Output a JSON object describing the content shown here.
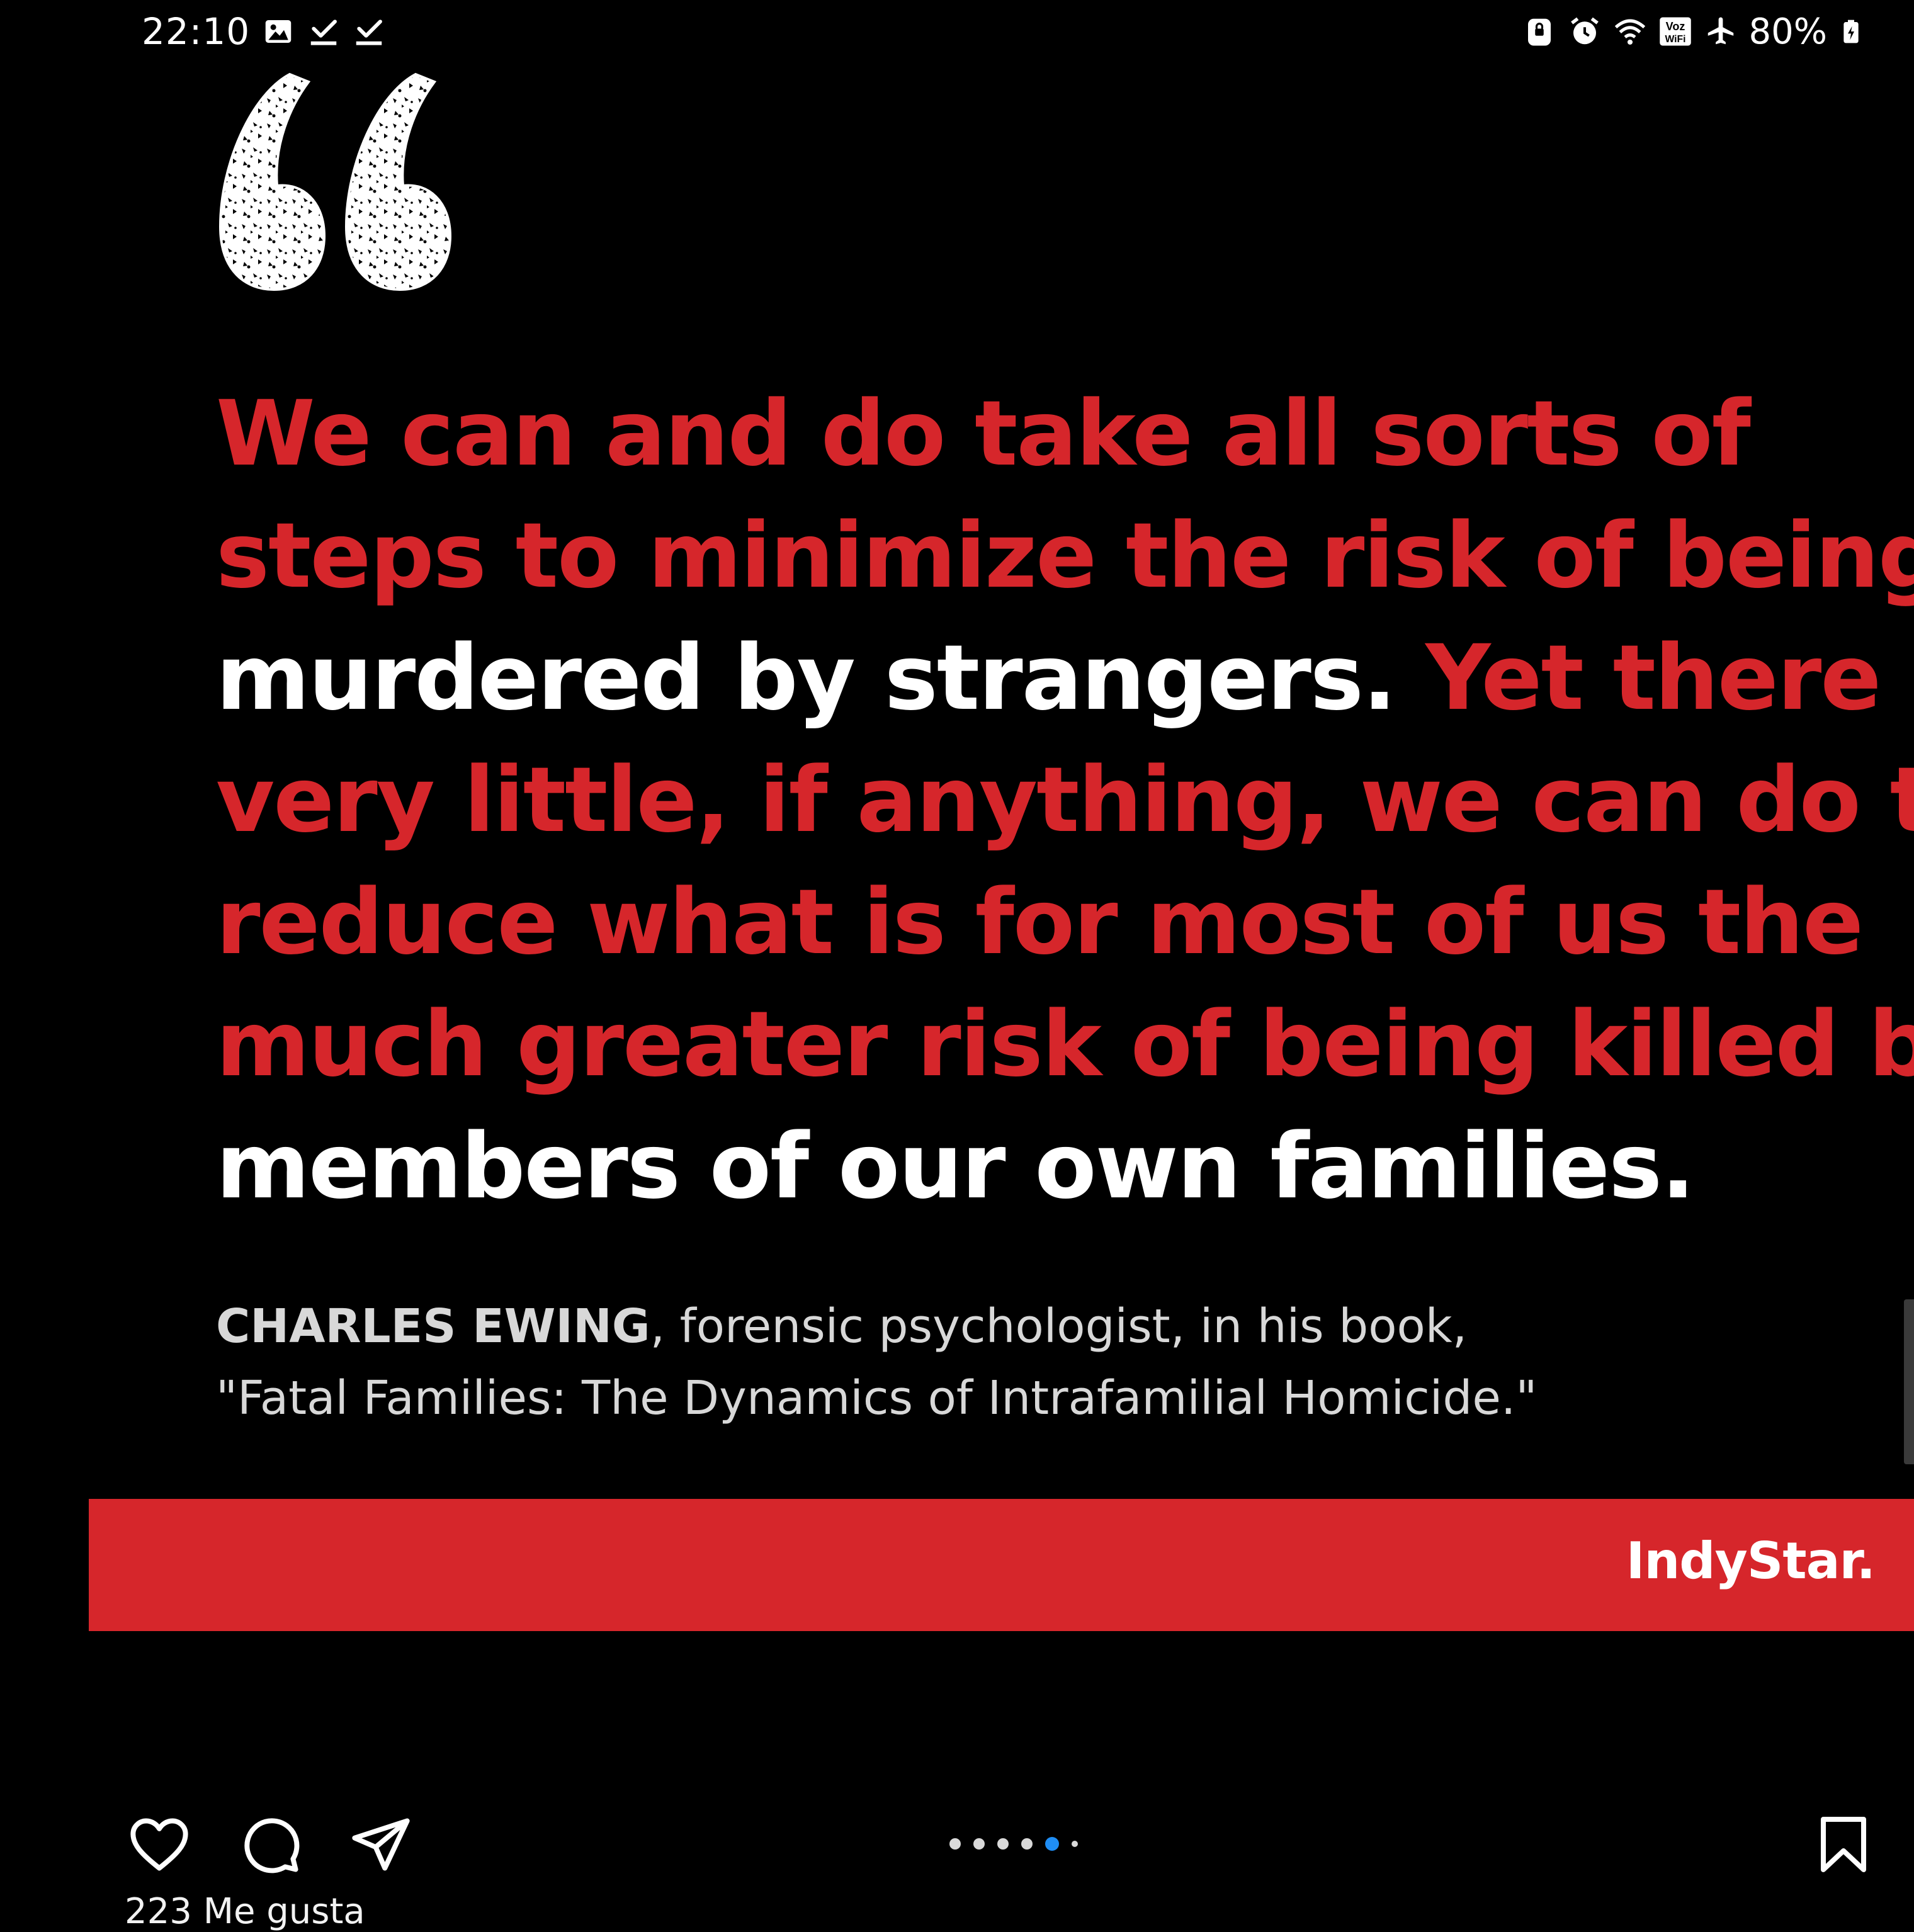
{
  "status_bar": {
    "time": "22:10",
    "battery": "80%",
    "left_icons": [
      "gallery-icon",
      "check-download-icon",
      "check-download-icon"
    ],
    "right_icons": [
      "lock-icon",
      "alarm-icon",
      "wifi-icon",
      "vowifi-icon",
      "airplane-icon",
      "battery-charging-icon"
    ],
    "vowifi_label_top": "Voz",
    "vowifi_label_bottom": "WiFi"
  },
  "post": {
    "quote_lines": [
      [
        {
          "text": "We can and do take all sorts of",
          "color": "red"
        }
      ],
      [
        {
          "text": "steps to minimize the risk of being",
          "color": "red"
        }
      ],
      [
        {
          "text": "murdered by strangers. ",
          "color": "white"
        },
        {
          "text": "Yet there is",
          "color": "red"
        }
      ],
      [
        {
          "text": "very little, if anything, we can do to",
          "color": "red"
        }
      ],
      [
        {
          "text": "reduce what is for most of us the",
          "color": "red"
        }
      ],
      [
        {
          "text": "much greater risk of being killed by",
          "color": "red"
        }
      ],
      [
        {
          "text": "members of our own families.",
          "color": "white"
        }
      ]
    ],
    "attribution": {
      "name": "CHARLES EWING",
      "line1_rest": ", forensic psychologist, in his book,",
      "line2": "\"Fatal Families: The Dynamics of Intrafamilial Homicide.\""
    },
    "brand": "IndyStar.",
    "colors": {
      "red": "#d6262b",
      "white": "#ffffff",
      "background": "#000000",
      "active_dot": "#1f8ef5"
    }
  },
  "actions": {
    "like_icon": "heart-icon",
    "comment_icon": "comment-bubble-icon",
    "share_icon": "paper-plane-icon",
    "save_icon": "bookmark-icon",
    "pager": {
      "total": 6,
      "active_index": 4
    },
    "likes_text": "223 Me gusta"
  }
}
